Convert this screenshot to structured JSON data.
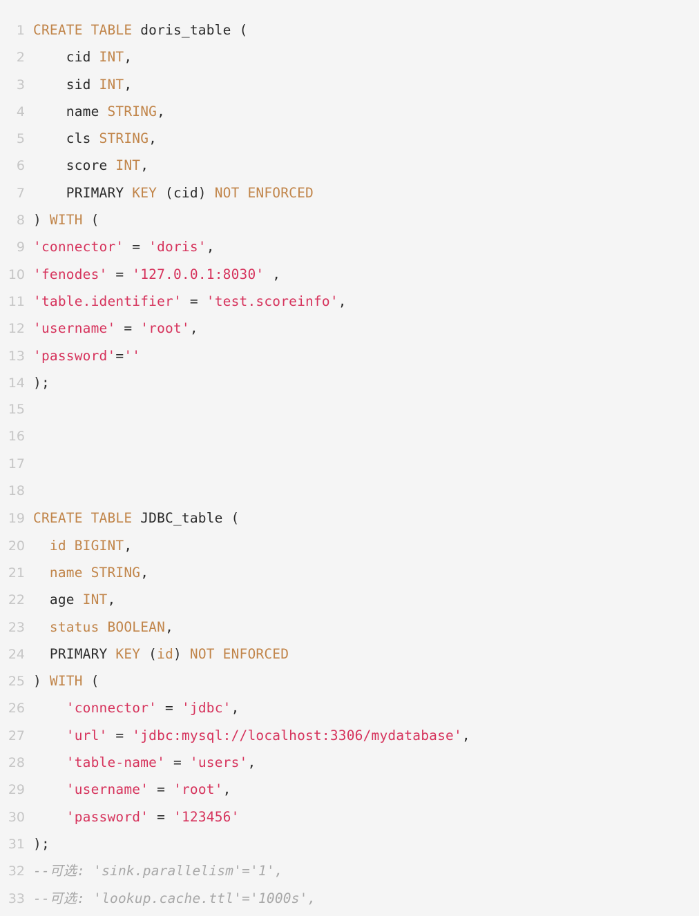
{
  "editor": {
    "language": "sql",
    "background_color": "#f5f5f5",
    "gutter_color": "#c6c6c6",
    "colors": {
      "keyword": "#c1854a",
      "string": "#d6335c",
      "text": "#2b2b2b",
      "comment": "#a8a8a8"
    },
    "first_line_number": 1,
    "last_line_number": 33,
    "lines": [
      {
        "number": "1",
        "tokens": [
          {
            "t": "CREATE TABLE",
            "c": "kw"
          },
          {
            "t": " doris_table (",
            "c": "txt"
          }
        ]
      },
      {
        "number": "2",
        "tokens": [
          {
            "t": "    cid ",
            "c": "txt"
          },
          {
            "t": "INT",
            "c": "kw"
          },
          {
            "t": ",",
            "c": "txt"
          }
        ]
      },
      {
        "number": "3",
        "tokens": [
          {
            "t": "    sid ",
            "c": "txt"
          },
          {
            "t": "INT",
            "c": "kw"
          },
          {
            "t": ",",
            "c": "txt"
          }
        ]
      },
      {
        "number": "4",
        "tokens": [
          {
            "t": "    name ",
            "c": "txt"
          },
          {
            "t": "STRING",
            "c": "kw"
          },
          {
            "t": ",",
            "c": "txt"
          }
        ]
      },
      {
        "number": "5",
        "tokens": [
          {
            "t": "    cls ",
            "c": "txt"
          },
          {
            "t": "STRING",
            "c": "kw"
          },
          {
            "t": ",",
            "c": "txt"
          }
        ]
      },
      {
        "number": "6",
        "tokens": [
          {
            "t": "    score ",
            "c": "txt"
          },
          {
            "t": "INT",
            "c": "kw"
          },
          {
            "t": ",",
            "c": "txt"
          }
        ]
      },
      {
        "number": "7",
        "tokens": [
          {
            "t": "    PRIMARY ",
            "c": "txt"
          },
          {
            "t": "KEY",
            "c": "kw"
          },
          {
            "t": " (cid) ",
            "c": "txt"
          },
          {
            "t": "NOT ENFORCED",
            "c": "kw"
          }
        ]
      },
      {
        "number": "8",
        "tokens": [
          {
            "t": ") ",
            "c": "txt"
          },
          {
            "t": "WITH",
            "c": "kw"
          },
          {
            "t": " (",
            "c": "txt"
          }
        ]
      },
      {
        "number": "9",
        "tokens": [
          {
            "t": "'connector'",
            "c": "str"
          },
          {
            "t": " = ",
            "c": "txt"
          },
          {
            "t": "'doris'",
            "c": "str"
          },
          {
            "t": ",",
            "c": "txt"
          }
        ]
      },
      {
        "number": "10",
        "tokens": [
          {
            "t": "'fenodes'",
            "c": "str"
          },
          {
            "t": " = ",
            "c": "txt"
          },
          {
            "t": "'127.0.0.1:8030'",
            "c": "str"
          },
          {
            "t": " ,",
            "c": "txt"
          }
        ]
      },
      {
        "number": "11",
        "tokens": [
          {
            "t": "'table.identifier'",
            "c": "str"
          },
          {
            "t": " = ",
            "c": "txt"
          },
          {
            "t": "'test.scoreinfo'",
            "c": "str"
          },
          {
            "t": ",",
            "c": "txt"
          }
        ]
      },
      {
        "number": "12",
        "tokens": [
          {
            "t": "'username'",
            "c": "str"
          },
          {
            "t": " = ",
            "c": "txt"
          },
          {
            "t": "'root'",
            "c": "str"
          },
          {
            "t": ",",
            "c": "txt"
          }
        ]
      },
      {
        "number": "13",
        "tokens": [
          {
            "t": "'password'",
            "c": "str"
          },
          {
            "t": "=",
            "c": "txt"
          },
          {
            "t": "''",
            "c": "str"
          }
        ]
      },
      {
        "number": "14",
        "tokens": [
          {
            "t": ");",
            "c": "txt"
          }
        ]
      },
      {
        "number": "15",
        "tokens": []
      },
      {
        "number": "16",
        "tokens": []
      },
      {
        "number": "17",
        "tokens": []
      },
      {
        "number": "18",
        "tokens": []
      },
      {
        "number": "19",
        "tokens": [
          {
            "t": "CREATE TABLE",
            "c": "kw"
          },
          {
            "t": " JDBC_table (",
            "c": "txt"
          }
        ]
      },
      {
        "number": "20",
        "tokens": [
          {
            "t": "  ",
            "c": "txt"
          },
          {
            "t": "id BIGINT",
            "c": "kw"
          },
          {
            "t": ",",
            "c": "txt"
          }
        ]
      },
      {
        "number": "21",
        "tokens": [
          {
            "t": "  ",
            "c": "txt"
          },
          {
            "t": "name STRING",
            "c": "kw"
          },
          {
            "t": ",",
            "c": "txt"
          }
        ]
      },
      {
        "number": "22",
        "tokens": [
          {
            "t": "  age ",
            "c": "txt"
          },
          {
            "t": "INT",
            "c": "kw"
          },
          {
            "t": ",",
            "c": "txt"
          }
        ]
      },
      {
        "number": "23",
        "tokens": [
          {
            "t": "  ",
            "c": "txt"
          },
          {
            "t": "status BOOLEAN",
            "c": "kw"
          },
          {
            "t": ",",
            "c": "txt"
          }
        ]
      },
      {
        "number": "24",
        "tokens": [
          {
            "t": "  PRIMARY ",
            "c": "txt"
          },
          {
            "t": "KEY",
            "c": "kw"
          },
          {
            "t": " (",
            "c": "txt"
          },
          {
            "t": "id",
            "c": "kw"
          },
          {
            "t": ") ",
            "c": "txt"
          },
          {
            "t": "NOT ENFORCED",
            "c": "kw"
          }
        ]
      },
      {
        "number": "25",
        "tokens": [
          {
            "t": ") ",
            "c": "txt"
          },
          {
            "t": "WITH",
            "c": "kw"
          },
          {
            "t": " (",
            "c": "txt"
          }
        ]
      },
      {
        "number": "26",
        "tokens": [
          {
            "t": "    ",
            "c": "txt"
          },
          {
            "t": "'connector'",
            "c": "str"
          },
          {
            "t": " = ",
            "c": "txt"
          },
          {
            "t": "'jdbc'",
            "c": "str"
          },
          {
            "t": ",",
            "c": "txt"
          }
        ]
      },
      {
        "number": "27",
        "tokens": [
          {
            "t": "    ",
            "c": "txt"
          },
          {
            "t": "'url'",
            "c": "str"
          },
          {
            "t": " = ",
            "c": "txt"
          },
          {
            "t": "'jdbc:mysql://localhost:3306/mydatabase'",
            "c": "str"
          },
          {
            "t": ",",
            "c": "txt"
          }
        ]
      },
      {
        "number": "28",
        "tokens": [
          {
            "t": "    ",
            "c": "txt"
          },
          {
            "t": "'table-name'",
            "c": "str"
          },
          {
            "t": " = ",
            "c": "txt"
          },
          {
            "t": "'users'",
            "c": "str"
          },
          {
            "t": ",",
            "c": "txt"
          }
        ]
      },
      {
        "number": "29",
        "tokens": [
          {
            "t": "    ",
            "c": "txt"
          },
          {
            "t": "'username'",
            "c": "str"
          },
          {
            "t": " = ",
            "c": "txt"
          },
          {
            "t": "'root'",
            "c": "str"
          },
          {
            "t": ",",
            "c": "txt"
          }
        ]
      },
      {
        "number": "30",
        "tokens": [
          {
            "t": "    ",
            "c": "txt"
          },
          {
            "t": "'password'",
            "c": "str"
          },
          {
            "t": " = ",
            "c": "txt"
          },
          {
            "t": "'123456'",
            "c": "str"
          }
        ]
      },
      {
        "number": "31",
        "tokens": [
          {
            "t": ");",
            "c": "txt"
          }
        ]
      },
      {
        "number": "32",
        "tokens": [
          {
            "t": "--可选: 'sink.parallelism'='1',",
            "c": "cmt"
          }
        ]
      },
      {
        "number": "33",
        "tokens": [
          {
            "t": "--可选: 'lookup.cache.ttl'='1000s',",
            "c": "cmt"
          }
        ]
      }
    ]
  }
}
